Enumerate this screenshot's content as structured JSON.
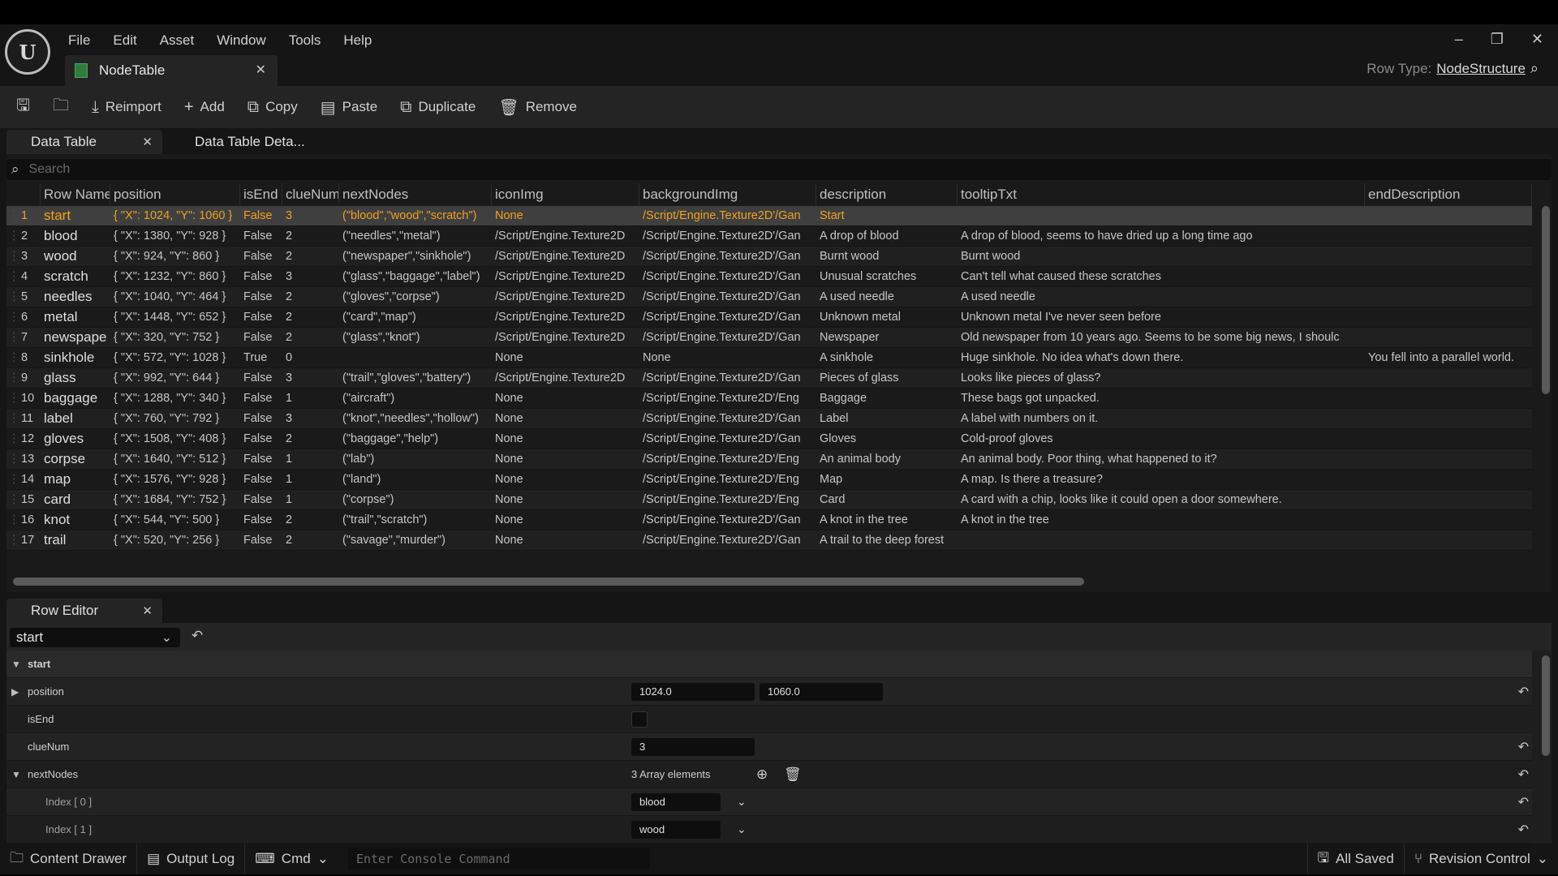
{
  "menu": [
    "File",
    "Edit",
    "Asset",
    "Window",
    "Tools",
    "Help"
  ],
  "document_tab": "NodeTable",
  "row_type": {
    "label": "Row Type:",
    "value": "NodeStructure"
  },
  "toolbar": {
    "reimport": "Reimport",
    "add": "Add",
    "copy": "Copy",
    "paste": "Paste",
    "duplicate": "Duplicate",
    "remove": "Remove"
  },
  "tabs": {
    "data_table": "Data Table",
    "details": "Data Table Deta..."
  },
  "search": {
    "placeholder": "Search"
  },
  "columns": [
    "Row Name",
    "position",
    "isEnd",
    "clueNum",
    "nextNodes",
    "iconImg",
    "backgroundImg",
    "description",
    "tooltipTxt",
    "endDescription"
  ],
  "rows": [
    [
      "1",
      "start",
      "{ \"X\": 1024, \"Y\": 1060 }",
      "False",
      "3",
      "(\"blood\",\"wood\",\"scratch\")",
      "None",
      "/Script/Engine.Texture2D'/Gan",
      "Start",
      "",
      ""
    ],
    [
      "2",
      "blood",
      "{ \"X\": 1380, \"Y\": 928 }",
      "False",
      "2",
      "(\"needles\",\"metal\")",
      "/Script/Engine.Texture2D",
      "/Script/Engine.Texture2D'/Gan",
      "A drop of blood",
      "A drop of blood, seems to have dried up a long time ago",
      ""
    ],
    [
      "3",
      "wood",
      "{ \"X\": 924, \"Y\": 860 }",
      "False",
      "2",
      "(\"newspaper\",\"sinkhole\")",
      "/Script/Engine.Texture2D",
      "/Script/Engine.Texture2D'/Gan",
      "Burnt wood",
      "Burnt wood",
      ""
    ],
    [
      "4",
      "scratch",
      "{ \"X\": 1232, \"Y\": 860 }",
      "False",
      "3",
      "(\"glass\",\"baggage\",\"label\")",
      "/Script/Engine.Texture2D",
      "/Script/Engine.Texture2D'/Gan",
      "Unusual scratches",
      "Can't tell what caused these scratches",
      ""
    ],
    [
      "5",
      "needles",
      "{ \"X\": 1040, \"Y\": 464 }",
      "False",
      "2",
      "(\"gloves\",\"corpse\")",
      "/Script/Engine.Texture2D",
      "/Script/Engine.Texture2D'/Gan",
      "A used needle",
      "A used needle",
      ""
    ],
    [
      "6",
      "metal",
      "{ \"X\": 1448, \"Y\": 652 }",
      "False",
      "2",
      "(\"card\",\"map\")",
      "/Script/Engine.Texture2D",
      "/Script/Engine.Texture2D'/Gan",
      "Unknown metal",
      "Unknown metal I've never seen before",
      ""
    ],
    [
      "7",
      "newspape",
      "{ \"X\": 320, \"Y\": 752 }",
      "False",
      "2",
      "(\"glass\",\"knot\")",
      "/Script/Engine.Texture2D",
      "/Script/Engine.Texture2D'/Gan",
      "Newspaper",
      "Old newspaper from 10 years ago. Seems to be some big news, I shoulc",
      ""
    ],
    [
      "8",
      "sinkhole",
      "{ \"X\": 572, \"Y\": 1028 }",
      "True",
      "0",
      "",
      "None",
      "None",
      "A sinkhole",
      "Huge sinkhole. No idea what's down there.",
      "You fell into a parallel world."
    ],
    [
      "9",
      "glass",
      "{ \"X\": 992, \"Y\": 644 }",
      "False",
      "3",
      "(\"trail\",\"gloves\",\"battery\")",
      "/Script/Engine.Texture2D",
      "/Script/Engine.Texture2D'/Gan",
      "Pieces of glass",
      "Looks like pieces of glass?",
      ""
    ],
    [
      "10",
      "baggage",
      "{ \"X\": 1288, \"Y\": 340 }",
      "False",
      "1",
      "(\"aircraft\")",
      "None",
      "/Script/Engine.Texture2D'/Eng",
      "Baggage",
      "These bags got unpacked.",
      ""
    ],
    [
      "11",
      "label",
      "{ \"X\": 760, \"Y\": 792 }",
      "False",
      "3",
      "(\"knot\",\"needles\",\"hollow\")",
      "None",
      "/Script/Engine.Texture2D'/Gan",
      "Label",
      "A label with numbers on it.",
      ""
    ],
    [
      "12",
      "gloves",
      "{ \"X\": 1508, \"Y\": 408 }",
      "False",
      "2",
      "(\"baggage\",\"help\")",
      "None",
      "/Script/Engine.Texture2D'/Gan",
      "Gloves",
      "Cold-proof gloves",
      ""
    ],
    [
      "13",
      "corpse",
      "{ \"X\": 1640, \"Y\": 512 }",
      "False",
      "1",
      "(\"lab\")",
      "None",
      "/Script/Engine.Texture2D'/Eng",
      "An animal body",
      "An animal body. Poor thing, what happened to it?",
      ""
    ],
    [
      "14",
      "map",
      "{ \"X\": 1576, \"Y\": 928 }",
      "False",
      "1",
      "(\"land\")",
      "None",
      "/Script/Engine.Texture2D'/Eng",
      "Map",
      "A map. Is there a treasure?",
      ""
    ],
    [
      "15",
      "card",
      "{ \"X\": 1684, \"Y\": 752 }",
      "False",
      "1",
      "(\"corpse\")",
      "None",
      "/Script/Engine.Texture2D'/Eng",
      "Card",
      "A card with a chip, looks like it could open a door somewhere.",
      ""
    ],
    [
      "16",
      "knot",
      "{ \"X\": 544, \"Y\": 500 }",
      "False",
      "2",
      "(\"trail\",\"scratch\")",
      "None",
      "/Script/Engine.Texture2D'/Gan",
      "A knot in the tree",
      "A knot in the tree",
      ""
    ],
    [
      "17",
      "trail",
      "{ \"X\": 520, \"Y\": 256 }",
      "False",
      "2",
      "(\"savage\",\"murder\")",
      "None",
      "/Script/Engine.Texture2D'/Gan",
      "A trail to the deep forest",
      "",
      ""
    ]
  ],
  "row_editor": {
    "tab": "Row Editor",
    "selected": "start",
    "section": "start",
    "position_label": "position",
    "pos_x": "1024.0",
    "pos_y": "1060.0",
    "isend_label": "isEnd",
    "cluenum_label": "clueNum",
    "cluenum_value": "3",
    "nextnodes_label": "nextNodes",
    "array_count": "3 Array elements",
    "index0_label": "Index [ 0 ]",
    "index0_value": "blood",
    "index1_label": "Index [ 1 ]",
    "index1_value": "wood"
  },
  "status": {
    "content_drawer": "Content Drawer",
    "output_log": "Output Log",
    "cmd": "Cmd",
    "console_placeholder": "Enter Console Command",
    "saved": "All Saved",
    "revision": "Revision Control"
  },
  "colors": {
    "accent_selected": "#f0a020",
    "panel": "#242424",
    "background": "#151515"
  }
}
